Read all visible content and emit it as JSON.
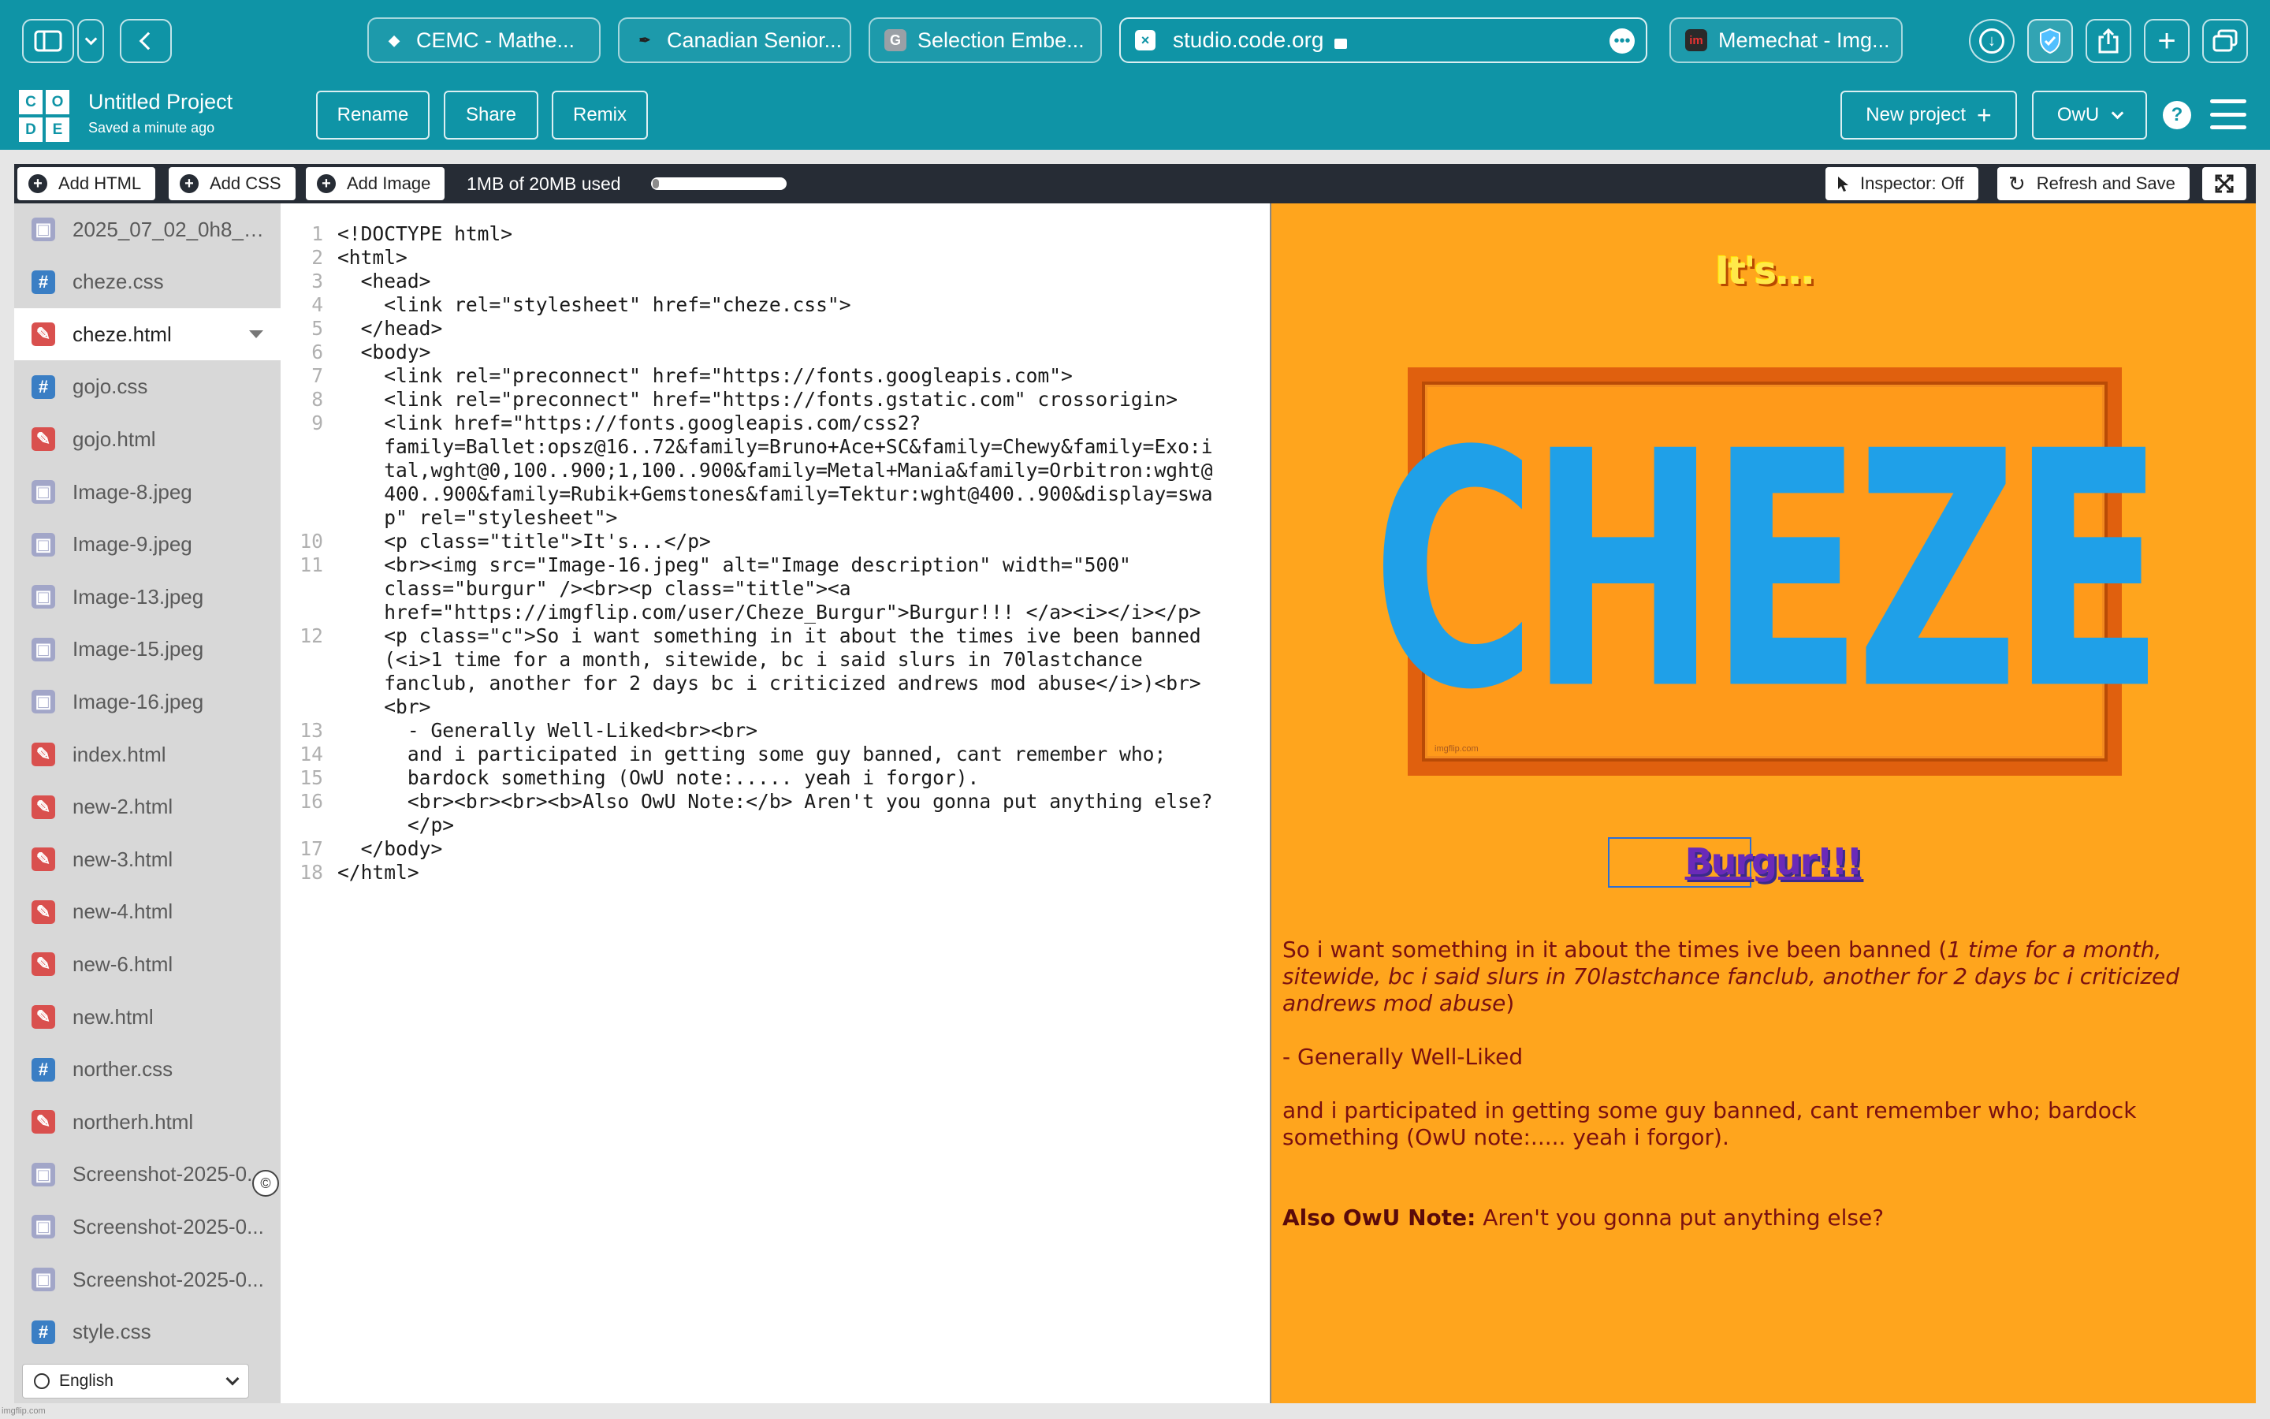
{
  "browser": {
    "tabs": [
      {
        "title": "CEMC - Mathe...",
        "icon": "diamond-icon"
      },
      {
        "title": "Canadian Senior...",
        "icon": "pen-icon"
      },
      {
        "title": "Selection Embe...",
        "icon": "g-icon"
      },
      {
        "title": "Memechat - Img...",
        "icon": "im-icon"
      }
    ],
    "address": "studio.code.org"
  },
  "app": {
    "logo_letters": [
      "C",
      "O",
      "D",
      "E"
    ],
    "project_title": "Untitled Project",
    "saved_status": "Saved a minute ago",
    "rename_label": "Rename",
    "share_label": "Share",
    "remix_label": "Remix",
    "new_project_label": "New project",
    "user_label": "OwU",
    "help_label": "?"
  },
  "toolbar": {
    "add_html": "Add HTML",
    "add_css": "Add CSS",
    "add_image": "Add Image",
    "usage_text": "1MB of 20MB used",
    "usage_fraction": 0.05,
    "inspector_label": "Inspector: Off",
    "refresh_label": "Refresh and Save"
  },
  "files": [
    {
      "name": "2025_07_02_0h8_Kl...",
      "type": "image"
    },
    {
      "name": "cheze.css",
      "type": "css"
    },
    {
      "name": "cheze.html",
      "type": "html",
      "active": true
    },
    {
      "name": "gojo.css",
      "type": "css"
    },
    {
      "name": "gojo.html",
      "type": "html"
    },
    {
      "name": "Image-8.jpeg",
      "type": "image"
    },
    {
      "name": "Image-9.jpeg",
      "type": "image"
    },
    {
      "name": "Image-13.jpeg",
      "type": "image"
    },
    {
      "name": "Image-15.jpeg",
      "type": "image"
    },
    {
      "name": "Image-16.jpeg",
      "type": "image"
    },
    {
      "name": "index.html",
      "type": "html"
    },
    {
      "name": "new-2.html",
      "type": "html"
    },
    {
      "name": "new-3.html",
      "type": "html"
    },
    {
      "name": "new-4.html",
      "type": "html"
    },
    {
      "name": "new-6.html",
      "type": "html"
    },
    {
      "name": "new.html",
      "type": "html"
    },
    {
      "name": "norther.css",
      "type": "css"
    },
    {
      "name": "northerh.html",
      "type": "html"
    },
    {
      "name": "Screenshot-2025-0...",
      "type": "image"
    },
    {
      "name": "Screenshot-2025-0...",
      "type": "image"
    },
    {
      "name": "Screenshot-2025-0...",
      "type": "image"
    },
    {
      "name": "style.css",
      "type": "css"
    }
  ],
  "language": "English",
  "code_lines": [
    {
      "n": "1",
      "t": "<!DOCTYPE html>"
    },
    {
      "n": "2",
      "t": "<html>"
    },
    {
      "n": "3",
      "t": "  <head>"
    },
    {
      "n": "4",
      "t": "    <link rel=\"stylesheet\" href=\"cheze.css\">"
    },
    {
      "n": "5",
      "t": "  </head>"
    },
    {
      "n": "6",
      "t": "  <body>"
    },
    {
      "n": "7",
      "t": "    <link rel=\"preconnect\" href=\"https://fonts.googleapis.com\">"
    },
    {
      "n": "8",
      "t": "    <link rel=\"preconnect\" href=\"https://fonts.gstatic.com\" crossorigin>"
    },
    {
      "n": "9",
      "t": "    <link href=\"https://fonts.googleapis.com/css2?"
    },
    {
      "n": "",
      "t": "    family=Ballet:opsz@16..72&family=Bruno+Ace+SC&family=Chewy&family=Exo:i"
    },
    {
      "n": "",
      "t": "    tal,wght@0,100..900;1,100..900&family=Metal+Mania&family=Orbitron:wght@"
    },
    {
      "n": "",
      "t": "    400..900&family=Rubik+Gemstones&family=Tektur:wght@400..900&display=swa"
    },
    {
      "n": "",
      "t": "    p\" rel=\"stylesheet\">"
    },
    {
      "n": "10",
      "t": "    <p class=\"title\">It's...</p>"
    },
    {
      "n": "11",
      "t": "    <br><img src=\"Image-16.jpeg\" alt=\"Image description\" width=\"500\""
    },
    {
      "n": "",
      "t": "    class=\"burgur\" /><br><p class=\"title\"><a"
    },
    {
      "n": "",
      "t": "    href=\"https://imgflip.com/user/Cheze_Burgur\">Burgur!!! </a><i></i></p>"
    },
    {
      "n": "12",
      "t": "    <p class=\"c\">So i want something in it about the times ive been banned"
    },
    {
      "n": "",
      "t": "    (<i>1 time for a month, sitewide, bc i said slurs in 70lastchance"
    },
    {
      "n": "",
      "t": "    fanclub, another for 2 days bc i criticized andrews mod abuse</i>)<br>"
    },
    {
      "n": "",
      "t": "    <br>"
    },
    {
      "n": "13",
      "t": "      - Generally Well-Liked<br><br>"
    },
    {
      "n": "14",
      "t": "      and i participated in getting some guy banned, cant remember who;"
    },
    {
      "n": "15",
      "t": "      bardock something (OwU note:..... yeah i forgor)."
    },
    {
      "n": "16",
      "t": "      <br><br><br><b>Also OwU Note:</b> Aren't you gonna put anything else?"
    },
    {
      "n": "",
      "t": "      </p>"
    },
    {
      "n": "17",
      "t": "  </body>"
    },
    {
      "n": "18",
      "t": "</html>"
    }
  ],
  "preview": {
    "title": "It's...",
    "meme_text": "CHEZE",
    "meme_watermark": "imgflip.com",
    "link_text": "Burgur!!!",
    "para1_plain": "So i want something in it about the times ive been banned (",
    "para1_italic": "1 time for a month, sitewide, bc i said slurs in 70lastchance fanclub, another for 2 days bc i criticized andrews mod abuse",
    "para1_close": ")",
    "para2": "- Generally Well-Liked",
    "para3": "and i participated in getting some guy banned, cant remember who; bardock something (OwU note:..... yeah i forgor).",
    "note_label": "Also OwU Note:",
    "note_text": " Aren't you gonna put anything else?"
  },
  "footer_watermark": "imgflip.com",
  "colors": {
    "teal": "#0f94a6",
    "preview_bg": "#ffa51d",
    "meme_text": "#1fa0e8"
  }
}
